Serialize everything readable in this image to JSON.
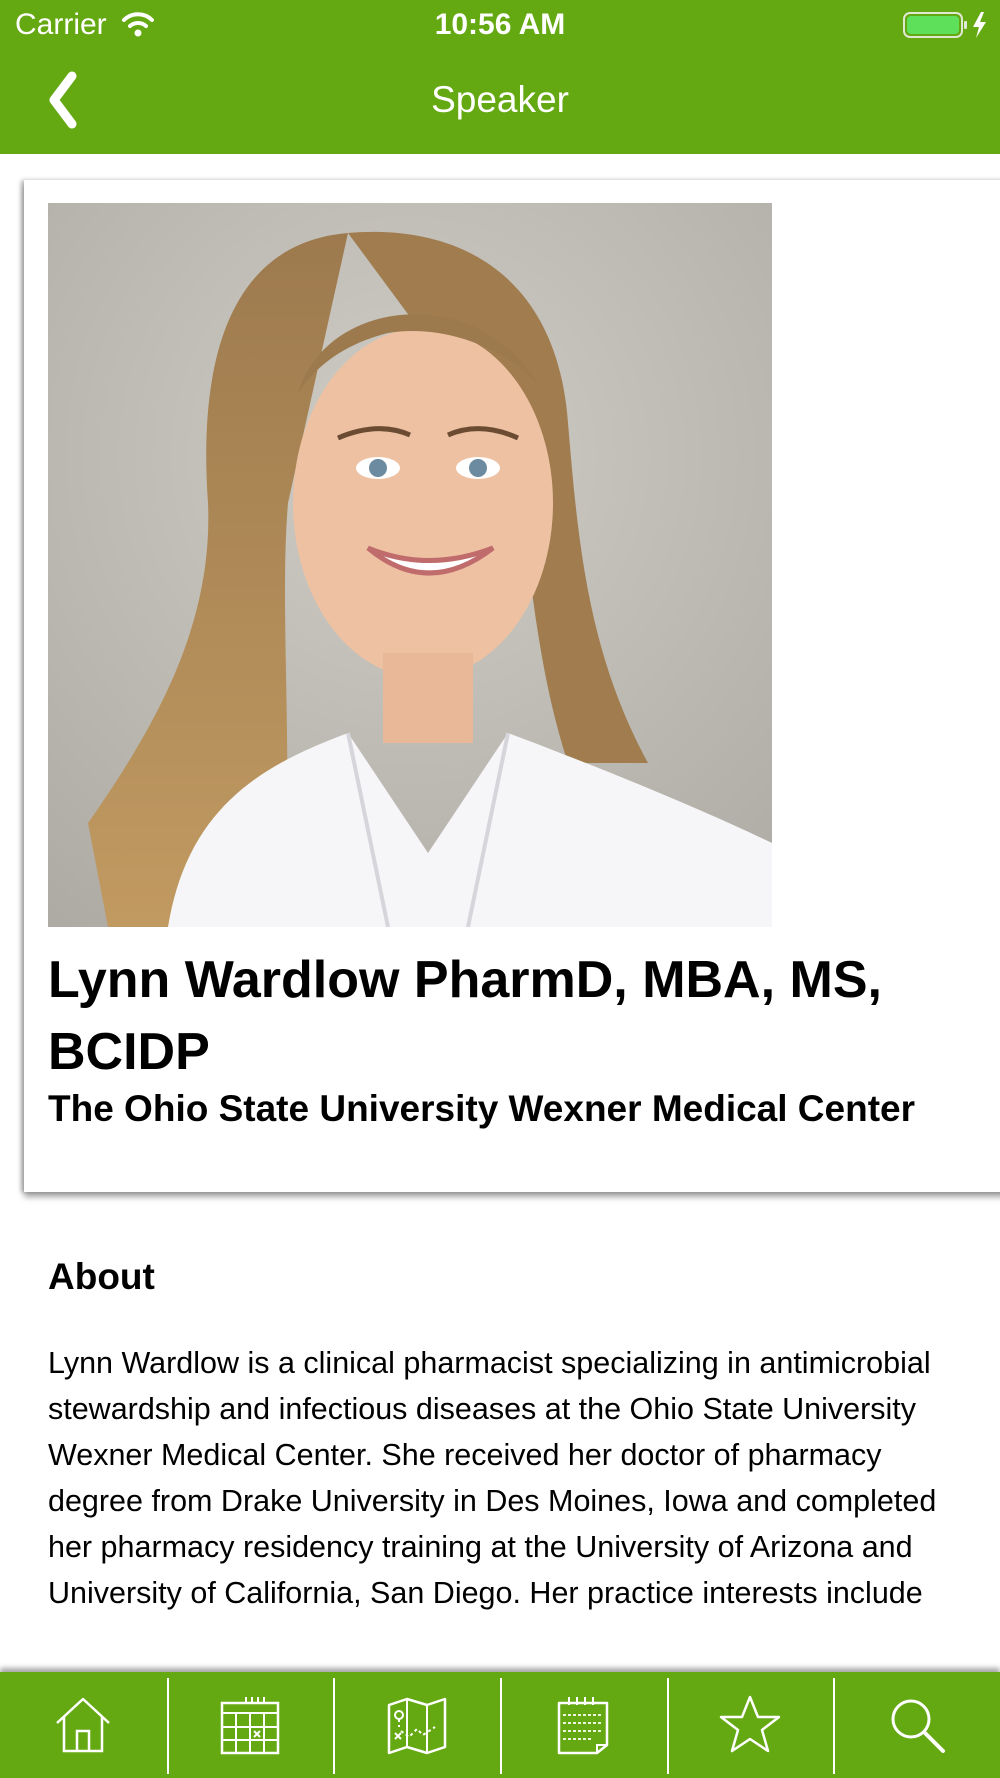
{
  "status_bar": {
    "carrier": "Carrier",
    "time": "10:56 AM"
  },
  "nav": {
    "title": "Speaker",
    "back_icon": "chevron-left-icon"
  },
  "speaker": {
    "name": "Lynn Wardlow PharmD, MBA, MS, BCIDP",
    "organization": "The Ohio State University Wexner Medical Center"
  },
  "about": {
    "heading": "About",
    "text": "Lynn Wardlow is a clinical pharmacist specializing in antimicrobial stewardship and infectious diseases at the Ohio State University Wexner Medical Center. She received her doctor of pharmacy degree from Drake University in Des Moines, Iowa and completed her pharmacy residency training at the University of Arizona and University of California, San Diego. Her practice interests include"
  },
  "tab_bar": {
    "tabs": [
      {
        "icon": "home-icon"
      },
      {
        "icon": "calendar-grid-icon"
      },
      {
        "icon": "map-icon"
      },
      {
        "icon": "notepad-icon"
      },
      {
        "icon": "star-icon"
      },
      {
        "icon": "search-icon"
      }
    ]
  },
  "colors": {
    "brand_green": "#64a812",
    "text": "#000000",
    "background": "#ffffff"
  }
}
